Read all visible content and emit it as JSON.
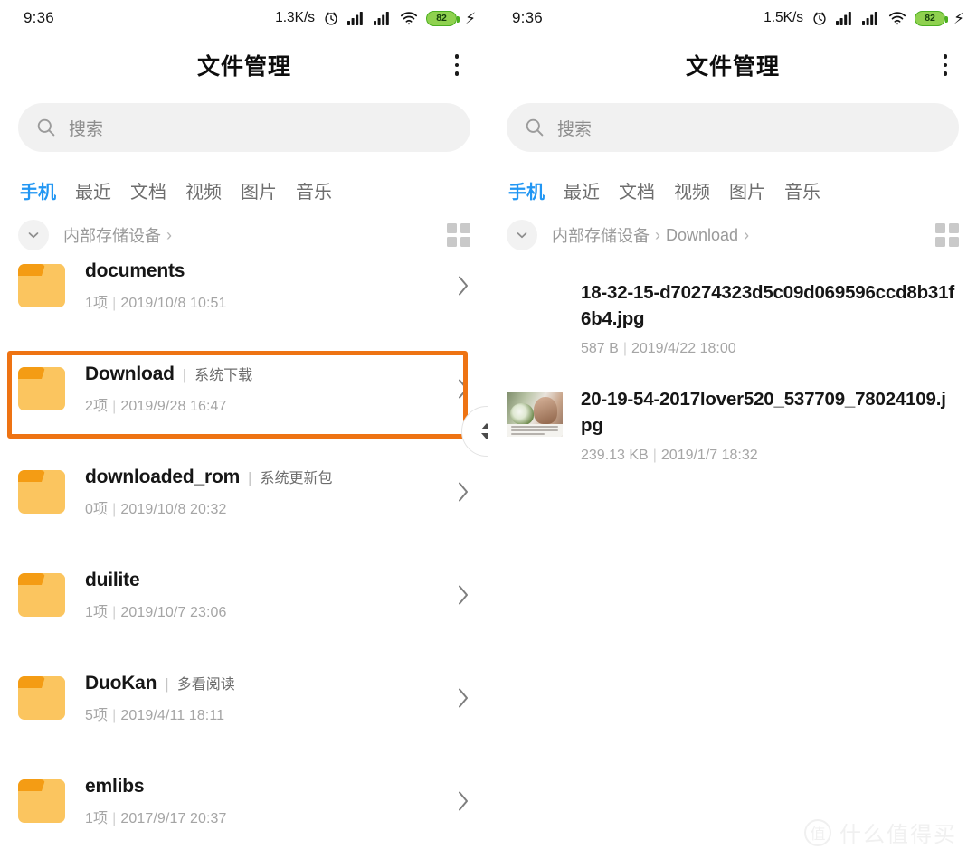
{
  "panels": [
    {
      "status": {
        "time": "9:36",
        "net_speed": "1.3K/s",
        "battery": "82"
      },
      "header": {
        "title": "文件管理",
        "menu_icon": "kebab-menu-icon"
      },
      "search": {
        "placeholder": "搜索",
        "icon": "search-icon"
      },
      "tabs": [
        {
          "label": "手机",
          "active": true
        },
        {
          "label": "最近",
          "active": false
        },
        {
          "label": "文档",
          "active": false
        },
        {
          "label": "视频",
          "active": false
        },
        {
          "label": "图片",
          "active": false
        },
        {
          "label": "音乐",
          "active": false
        }
      ],
      "breadcrumb": {
        "collapse_icon": "chevron-down-icon",
        "crumbs": [
          "内部存储设备"
        ],
        "grid_icon": "grid-view-icon"
      },
      "rows": [
        {
          "name": "documents",
          "alias": "",
          "count": "1项",
          "date": "2019/10/8 10:51",
          "clipped": true,
          "highlighted": false
        },
        {
          "name": "Download",
          "alias": "系统下载",
          "count": "2项",
          "date": "2019/9/28 16:47",
          "clipped": false,
          "highlighted": true
        },
        {
          "name": "downloaded_rom",
          "alias": "系统更新包",
          "count": "0项",
          "date": "2019/10/8 20:32",
          "clipped": false,
          "highlighted": false
        },
        {
          "name": "duilite",
          "alias": "",
          "count": "1项",
          "date": "2019/10/7 23:06",
          "clipped": false,
          "highlighted": false
        },
        {
          "name": "DuoKan",
          "alias": "多看阅读",
          "count": "5项",
          "date": "2019/4/11 18:11",
          "clipped": false,
          "highlighted": false
        },
        {
          "name": "emlibs",
          "alias": "",
          "count": "1项",
          "date": "2017/9/17 20:37",
          "clipped": false,
          "highlighted": false
        }
      ],
      "scroll_handle": {
        "up_icon": "triangle-up-icon",
        "down_icon": "triangle-down-icon"
      }
    },
    {
      "status": {
        "time": "9:36",
        "net_speed": "1.5K/s",
        "battery": "82"
      },
      "header": {
        "title": "文件管理",
        "menu_icon": "kebab-menu-icon"
      },
      "search": {
        "placeholder": "搜索",
        "icon": "search-icon"
      },
      "tabs": [
        {
          "label": "手机",
          "active": true
        },
        {
          "label": "最近",
          "active": false
        },
        {
          "label": "文档",
          "active": false
        },
        {
          "label": "视频",
          "active": false
        },
        {
          "label": "图片",
          "active": false
        },
        {
          "label": "音乐",
          "active": false
        }
      ],
      "breadcrumb": {
        "collapse_icon": "chevron-down-icon",
        "crumbs": [
          "内部存储设备",
          "Download"
        ],
        "grid_icon": "grid-view-icon"
      },
      "files": [
        {
          "name": "18-32-15-d70274323d5c09d069596ccd8b31f6b4.jpg",
          "size": "587 B",
          "date": "2019/4/22 18:00",
          "thumb": false
        },
        {
          "name": "20-19-54-2017lover520_537709_78024109.jpg",
          "size": "239.13 KB",
          "date": "2019/1/7 18:32",
          "thumb": true
        }
      ],
      "watermark": {
        "mark": "值",
        "text": "什么值得买"
      }
    }
  ],
  "colors": {
    "accent_blue": "#2196f3",
    "highlight_orange": "#ee7313",
    "folder_body": "#fbc55f",
    "folder_tab": "#f49c14",
    "battery_green": "#8fd14f"
  }
}
